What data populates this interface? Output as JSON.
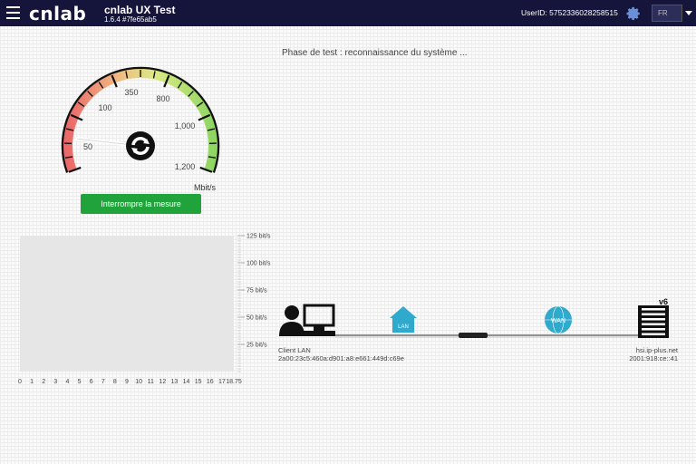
{
  "header": {
    "logo_text": "cnlab",
    "app_title": "cnlab UX Test",
    "app_version": "1.6.4 #7fe65ab5",
    "user_id": "UserID: 5752336028258515",
    "language": "FR",
    "brand_color": "#15153c",
    "icons": [
      "menu-icon",
      "gear-icon",
      "chevron-down-icon"
    ]
  },
  "status": {
    "phase": "Phase de test : reconnaissance du système ..."
  },
  "gauge": {
    "tick_labels": [
      "50",
      "100",
      "350",
      "800",
      "1,000",
      "1,200"
    ],
    "unit": "Mbit/s",
    "needle_value_fraction": 0.12
  },
  "controls": {
    "stop_button_label": "Interrompre la mesure",
    "stop_button_color": "#1fa33a"
  },
  "chart_data": {
    "type": "area",
    "title": "",
    "xlabel": "",
    "ylabel": "",
    "x_ticks": [
      "0",
      "1",
      "2",
      "3",
      "4",
      "5",
      "6",
      "7",
      "8",
      "9",
      "10",
      "11",
      "12",
      "13",
      "14",
      "15",
      "16",
      "17",
      "18.75"
    ],
    "y_ticks": [
      "25 bit/s",
      "50 bit/s",
      "75 bit/s",
      "100 bit/s",
      "125 bit/s"
    ],
    "ylim": [
      0,
      125
    ],
    "grid": false,
    "series": []
  },
  "network": {
    "client_title": "Client LAN",
    "client_address": "2a00:23c5:460a:d901:a8:e661:449d:c69e",
    "lan_label": "LAN",
    "wan_label": "WAN",
    "server_badge": "v6",
    "server_host": "hsi.ip-plus.net",
    "server_address": "2001:918:ce::41"
  }
}
